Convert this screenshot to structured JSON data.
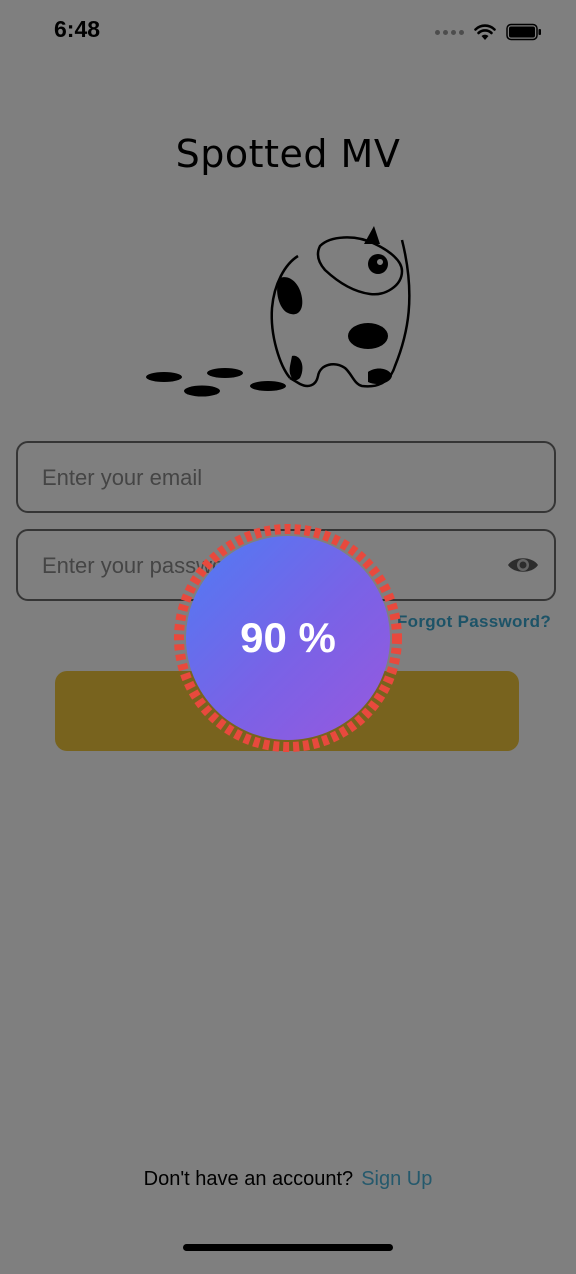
{
  "status_bar": {
    "time": "6:48"
  },
  "app": {
    "title": "Spotted MV"
  },
  "form": {
    "email_placeholder": "Enter your email",
    "password_placeholder": "Enter your password",
    "forgot_password": "Forgot Password?",
    "login_button_color": "#f0c63c"
  },
  "footer": {
    "prompt": "Don't have an account?",
    "signup_label": "Sign Up"
  },
  "loading": {
    "percent_label": "90 %",
    "progress": 0.9,
    "ring_color": "#e8493d"
  },
  "icons": {
    "logo": "spotted-dog-logo",
    "eye": "eye-icon",
    "wifi": "wifi-icon",
    "battery": "battery-icon"
  }
}
